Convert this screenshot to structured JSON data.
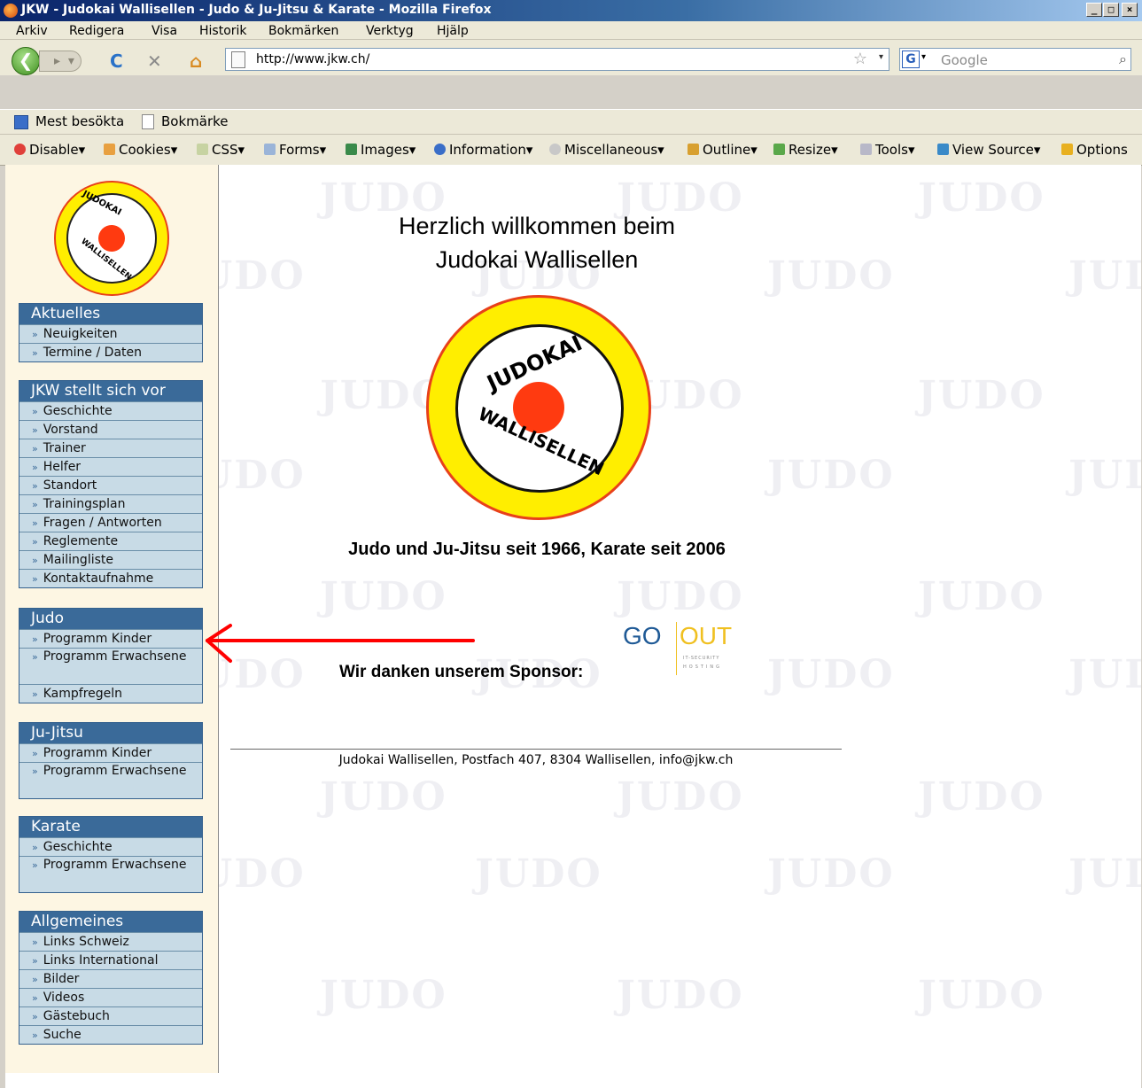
{
  "window": {
    "title": "JKW - Judokai Wallisellen - Judo & Ju-Jitsu & Karate - Mozilla Firefox"
  },
  "menu": [
    "Arkiv",
    "Redigera",
    "Visa",
    "Historik",
    "Bokmärken",
    "Verktyg",
    "Hjälp"
  ],
  "navbar": {
    "url": "http://www.jkw.ch/",
    "search_placeholder": "Google"
  },
  "bookmarks": [
    "Mest besökta",
    "Bokmärke"
  ],
  "devtoolbar": [
    "Disable",
    "Cookies",
    "CSS",
    "Forms",
    "Images",
    "Information",
    "Miscellaneous",
    "Outline",
    "Resize",
    "Tools",
    "View Source",
    "Options"
  ],
  "sidebar": {
    "sections": [
      {
        "title": "Aktuelles",
        "items": [
          "Neuigkeiten",
          "Termine / Daten"
        ]
      },
      {
        "title": "JKW stellt sich vor",
        "items": [
          "Geschichte",
          "Vorstand",
          "Trainer",
          "Helfer",
          "Standort",
          "Trainingsplan",
          "Fragen / Antworten",
          "Reglemente",
          "Mailingliste",
          "Kontaktaufnahme"
        ]
      },
      {
        "title": "Judo",
        "items": [
          "Programm Kinder",
          "Programm Erwachsene",
          "Kampfregeln"
        ]
      },
      {
        "title": "Ju-Jitsu",
        "items": [
          "Programm Kinder",
          "Programm Erwachsene"
        ]
      },
      {
        "title": "Karate",
        "items": [
          "Geschichte",
          "Programm Erwachsene"
        ]
      },
      {
        "title": "Allgemeines",
        "items": [
          "Links Schweiz",
          "Links International",
          "Bilder",
          "Videos",
          "Gästebuch",
          "Suche"
        ]
      }
    ]
  },
  "logo": {
    "top_text": "JUDOKAI",
    "bottom_text": "WALLISELLEN"
  },
  "main": {
    "welcome_line1": "Herzlich willkommen beim",
    "welcome_line2": "Judokai Wallisellen",
    "since": "Judo und Ju-Jitsu seit 1966, Karate seit 2006",
    "sponsor_label": "Wir danken unserem Sponsor:",
    "sponsor_logo_go": "GO",
    "sponsor_logo_out": "OUT",
    "sponsor_logo_sub1": "IT-SECURITY",
    "sponsor_logo_sub2": "HOSTING",
    "footer": "Judokai Wallisellen, Postfach 407, 8304 Wallisellen, info@jkw.ch"
  },
  "watermark": "JUDO",
  "colors": {
    "sidebar_header": "#3a6a99",
    "sidebar_item": "#c8dbe6",
    "sidebar_bg": "#fdf6e3",
    "logo_yellow": "#ffee00",
    "logo_red": "#ff3a10",
    "arrow": "#ff0000"
  }
}
